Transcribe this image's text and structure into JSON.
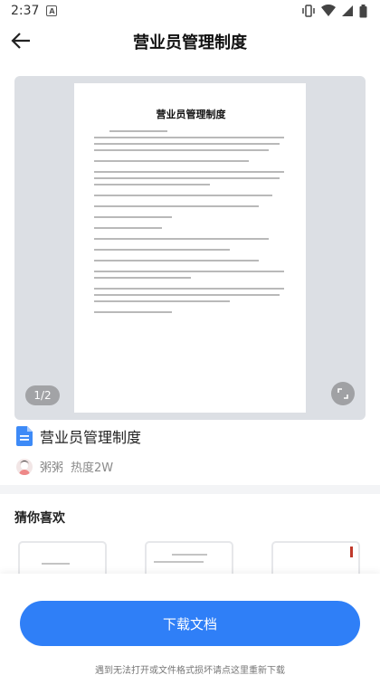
{
  "status_bar": {
    "time": "2:37",
    "notif_letter": "A"
  },
  "header": {
    "title": "营业员管理制度"
  },
  "preview": {
    "doc_heading": "营业员管理制度",
    "page_indicator": "1/2"
  },
  "document": {
    "name": "营业员管理制度",
    "author": "粥粥",
    "popularity": "热度2W"
  },
  "recommend": {
    "title": "猜你喜欢"
  },
  "bottom": {
    "download_label": "下载文档",
    "hint": "遇到无法打开或文件格式损坏请点这里重新下载"
  },
  "colors": {
    "accent": "#2f7ff7",
    "doc_icon": "#3d8af7"
  }
}
